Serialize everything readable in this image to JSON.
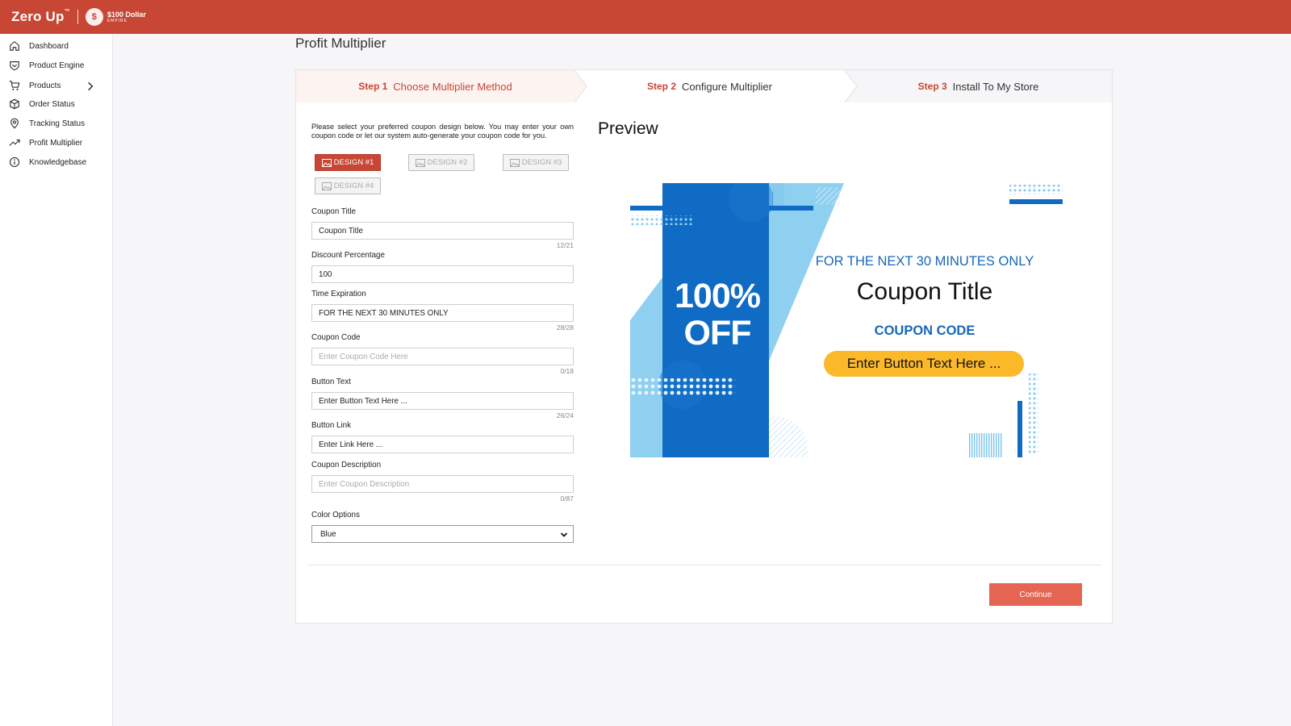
{
  "brand": {
    "name": "Zero Up",
    "partner_line1": "$100 Dollar",
    "partner_line2": "EMPIRE",
    "partner_badge": "$"
  },
  "sidebar": {
    "items": [
      {
        "label": "Dashboard",
        "icon": "home-icon"
      },
      {
        "label": "Product Engine",
        "icon": "shield-icon"
      },
      {
        "label": "Products",
        "icon": "cart-icon"
      },
      {
        "label": "Order Status",
        "icon": "box-icon"
      },
      {
        "label": "Tracking Status",
        "icon": "location-pin-icon"
      },
      {
        "label": "Profit Multiplier",
        "icon": "trending-up-icon"
      },
      {
        "label": "Knowledgebase",
        "icon": "info-icon"
      }
    ]
  },
  "page": {
    "title": "Profit Multiplier"
  },
  "steps": [
    {
      "num": "Step 1",
      "label": "Choose Multiplier Method"
    },
    {
      "num": "Step 2",
      "label": "Configure Multiplier"
    },
    {
      "num": "Step 3",
      "label": "Install To My Store"
    }
  ],
  "form": {
    "intro": "Please select your preferred coupon design below. You may enter your own coupon code or let our system auto-generate your coupon code for you.",
    "designs": [
      "DESIGN #1",
      "DESIGN #2",
      "DESIGN #3",
      "DESIGN #4"
    ],
    "coupon_title": {
      "label": "Coupon Title",
      "value": "Coupon Title",
      "count": "12/21"
    },
    "discount": {
      "label": "Discount Percentage",
      "value": "100"
    },
    "time_expiration": {
      "label": "Time Expiration",
      "value": "FOR THE NEXT 30 MINUTES ONLY",
      "count": "28/28"
    },
    "coupon_code": {
      "label": "Coupon Code",
      "placeholder": "Enter Coupon Code Here",
      "count": "0/18"
    },
    "button_text": {
      "label": "Button Text",
      "value": "Enter Button Text Here ...",
      "count": "26/24"
    },
    "button_link": {
      "label": "Button Link",
      "value": "Enter Link Here ..."
    },
    "coupon_description": {
      "label": "Coupon Description",
      "placeholder": "Enter Coupon Description",
      "count": "0/87"
    },
    "color_options": {
      "label": "Color Options",
      "value": "Blue"
    }
  },
  "preview": {
    "title": "Preview",
    "discount_line1": "100%",
    "discount_line2": "OFF",
    "subtitle": "FOR THE NEXT 30 MINUTES ONLY",
    "coupon_title": "Coupon Title",
    "coupon_code": "COUPON CODE",
    "button_text": "Enter Button Text Here ..."
  },
  "actions": {
    "continue": "Continue"
  },
  "colors": {
    "brand": "#c84634",
    "coupon_blue": "#0f6bc4",
    "coupon_light_blue": "#7cc4ec",
    "coupon_button": "#fbb92a",
    "continue": "#e56452"
  }
}
